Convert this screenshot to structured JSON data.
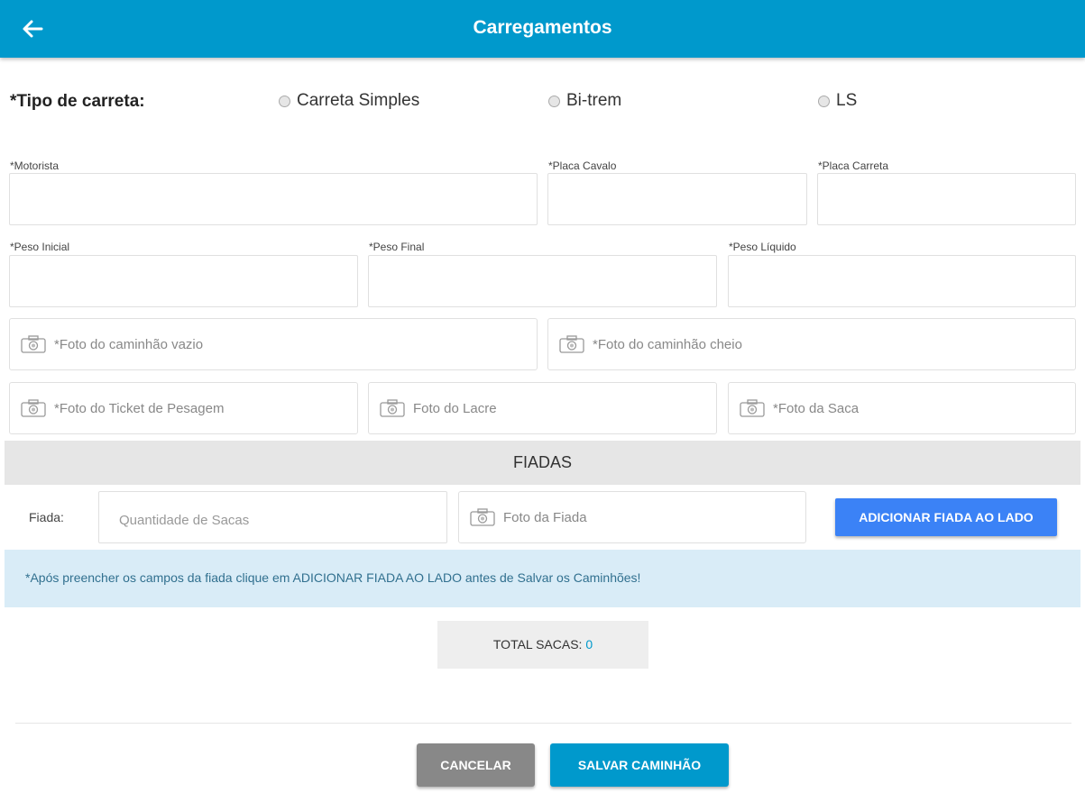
{
  "appbar": {
    "title": "Carregamentos",
    "back_icon": "arrow-left-icon"
  },
  "tipo_carreta": {
    "label": "*Tipo de carreta:",
    "options": [
      "Carreta Simples",
      "Bi-trem",
      "LS"
    ]
  },
  "fields": {
    "motorista": {
      "label": "*Motorista",
      "value": ""
    },
    "placa_cavalo": {
      "label": "*Placa Cavalo",
      "value": ""
    },
    "placa_carreta": {
      "label": "*Placa Carreta",
      "value": ""
    },
    "peso_inicial": {
      "label": "*Peso Inicial",
      "value": ""
    },
    "peso_final": {
      "label": "*Peso Final",
      "value": ""
    },
    "peso_liquido": {
      "label": "*Peso Líquido",
      "value": ""
    }
  },
  "photos": {
    "caminhao_vazio": "*Foto do caminhão vazio",
    "caminhao_cheio": "*Foto do caminhão cheio",
    "ticket_pesagem": "*Foto do Ticket de Pesagem",
    "lacre": "Foto do Lacre",
    "saca": "*Foto da Saca",
    "icon": "camera-icon"
  },
  "fiadas": {
    "header": "FIADAS",
    "fiada_label": "Fiada:",
    "quantidade_placeholder": "Quantidade de Sacas",
    "foto_fiada": "Foto da Fiada",
    "add_button": "ADICIONAR FIADA AO LADO"
  },
  "info_message": "*Após preencher os campos da fiada clique em ADICIONAR FIADA AO LADO antes de Salvar os Caminhões!",
  "total": {
    "label": "TOTAL SACAS: ",
    "value": "0"
  },
  "actions": {
    "cancel": "CANCELAR",
    "save": "SALVAR CAMINHÃO"
  },
  "colors": {
    "primary": "#0099cc",
    "add_button": "#3b82f6",
    "cancel_button": "#888888",
    "info_bg": "#d9ecf7",
    "info_text": "#31708f"
  }
}
